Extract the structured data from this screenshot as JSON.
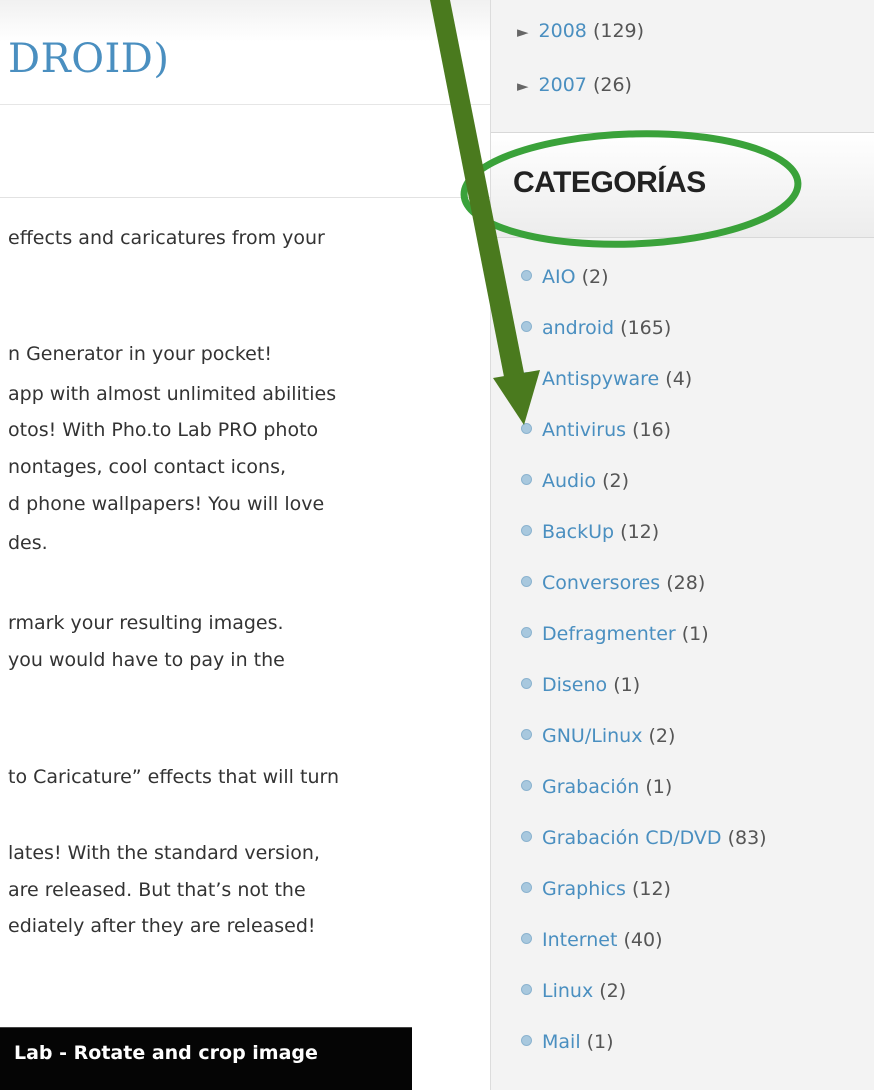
{
  "post": {
    "title": "DROID)",
    "body_lines": [
      "effects and caricatures from your",
      "n Generator in your pocket!",
      "app with almost unlimited abilities",
      "otos! With Pho.to Lab PRO photo",
      "nontages, cool contact icons,",
      "d phone wallpapers! You will love",
      "des.",
      "rmark your resulting images.",
      "you would have to pay in the",
      "to Caricature” effects that will turn",
      "lates! With the standard version,",
      "are released. But that’s not the",
      "ediately after they are released!"
    ],
    "image_caption": "Lab - Rotate and crop image"
  },
  "sidebar": {
    "archive": [
      {
        "year": "2008",
        "count": "(129)",
        "icon": "triangle-right-icon"
      },
      {
        "year": "2007",
        "count": "(26)",
        "icon": "triangle-right-icon"
      }
    ],
    "categories_title": "CATEGORÍAS",
    "categories": [
      {
        "name": "AIO",
        "count": "(2)"
      },
      {
        "name": "android",
        "count": "(165)"
      },
      {
        "name": "Antispyware",
        "count": "(4)"
      },
      {
        "name": "Antivirus",
        "count": "(16)"
      },
      {
        "name": "Audio",
        "count": "(2)"
      },
      {
        "name": "BackUp",
        "count": "(12)"
      },
      {
        "name": "Conversores",
        "count": "(28)"
      },
      {
        "name": "Defragmenter",
        "count": "(1)"
      },
      {
        "name": "Diseno",
        "count": "(1)"
      },
      {
        "name": "GNU/Linux",
        "count": "(2)"
      },
      {
        "name": "Grabación",
        "count": "(1)"
      },
      {
        "name": "Grabación CD/DVD",
        "count": "(83)"
      },
      {
        "name": "Graphics",
        "count": "(12)"
      },
      {
        "name": "Internet",
        "count": "(40)"
      },
      {
        "name": "Linux",
        "count": "(2)"
      },
      {
        "name": "Mail",
        "count": "(1)"
      }
    ]
  },
  "annotation": {
    "arrow_icon": "down-arrow-icon",
    "ellipse_icon": "highlight-ellipse-icon",
    "arrow_color": "#4a7a1e",
    "ellipse_color": "#3aa23a"
  },
  "colors": {
    "link": "#4a8fc0",
    "text": "#333333",
    "sidebar_bg": "#f3f3f3"
  }
}
